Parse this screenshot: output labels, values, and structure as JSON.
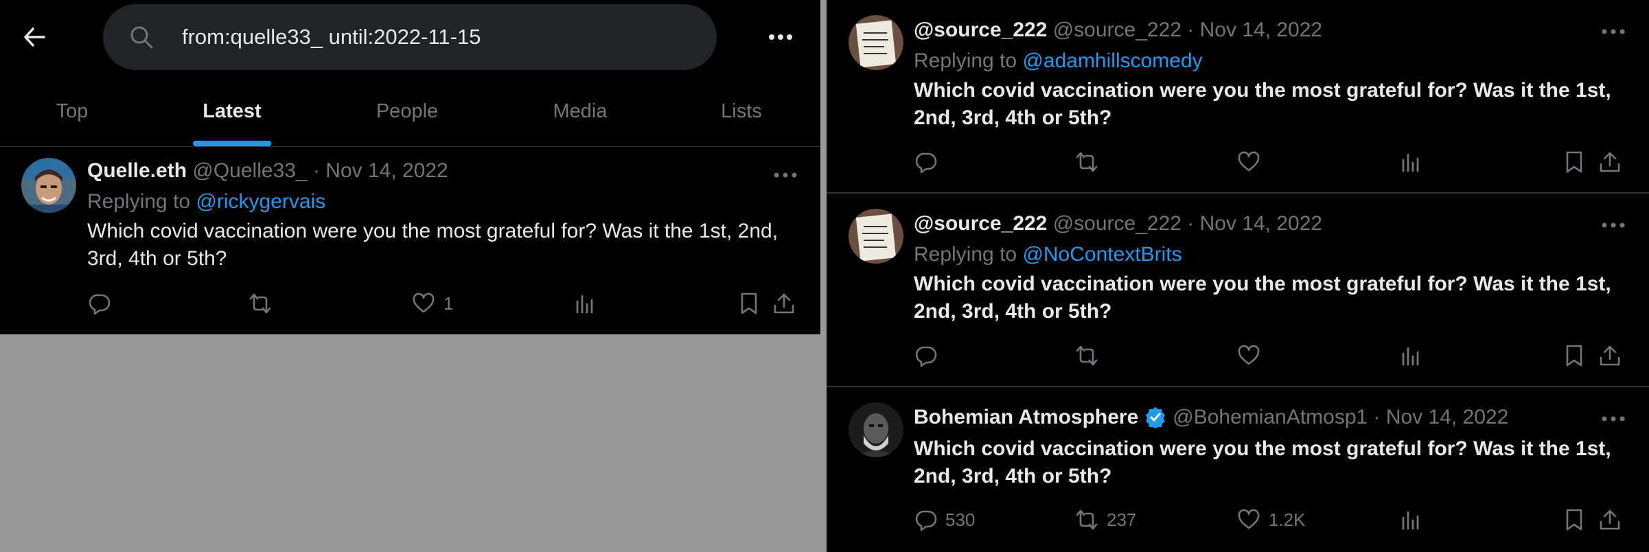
{
  "search": {
    "query": "from:quelle33_ until:2022-11-15"
  },
  "tabs": [
    {
      "label": "Top"
    },
    {
      "label": "Latest"
    },
    {
      "label": "People"
    },
    {
      "label": "Media"
    },
    {
      "label": "Lists"
    }
  ],
  "active_tab": "Latest",
  "left_tweet": {
    "name": "Quelle.eth",
    "meta": "@Quelle33_ · Nov 14, 2022",
    "replying_prefix": "Replying to ",
    "replying_to": "@rickygervais",
    "text": "Which covid vaccination were you the most grateful for? Was it the 1st, 2nd, 3rd, 4th or 5th?",
    "likes": "1"
  },
  "right_tweets": [
    {
      "name": "@source_222",
      "meta": "@source_222 · Nov 14, 2022",
      "replying_prefix": "Replying to ",
      "replying_to": "@adamhillscomedy",
      "text": "Which covid vaccination were you the most grateful for? Was it the 1st, 2nd, 3rd, 4th or 5th?"
    },
    {
      "name": "@source_222",
      "meta": "@source_222 · Nov 14, 2022",
      "replying_prefix": "Replying to ",
      "replying_to": "@NoContextBrits",
      "text": "Which covid vaccination were you the most grateful for? Was it the 1st, 2nd, 3rd, 4th or 5th?"
    },
    {
      "name": "Bohemian Atmosphere",
      "meta": "@BohemianAtmosp1 · Nov 14, 2022",
      "text": "Which covid vaccination were you the most grateful for? Was it the 1st, 2nd, 3rd, 4th or 5th?",
      "replies": "530",
      "retweets": "237",
      "likes": "1.2K"
    }
  ],
  "colors": {
    "background": "#000000",
    "accent": "#1d9bf0",
    "muted": "#71767b",
    "text": "#e7e9ea",
    "gap": "#999999"
  },
  "icons": [
    "back-arrow-icon",
    "search-icon",
    "more-icon",
    "reply-icon",
    "retweet-icon",
    "like-icon",
    "views-icon",
    "bookmark-icon",
    "share-icon",
    "verified-icon"
  ]
}
